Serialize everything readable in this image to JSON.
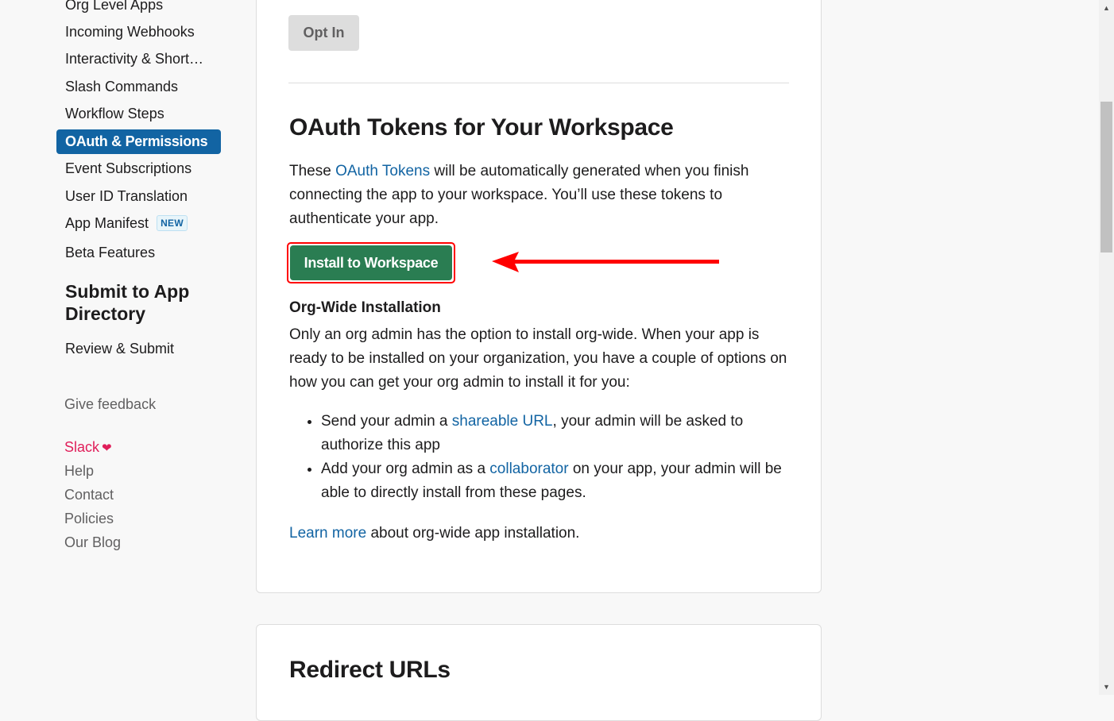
{
  "sidebar": {
    "items": [
      {
        "label": "Org Level Apps"
      },
      {
        "label": "Incoming Webhooks"
      },
      {
        "label": "Interactivity & Short…"
      },
      {
        "label": "Slash Commands"
      },
      {
        "label": "Workflow Steps"
      },
      {
        "label": "OAuth & Permissions",
        "active": true
      },
      {
        "label": "Event Subscriptions"
      },
      {
        "label": "User ID Translation"
      },
      {
        "label": "App Manifest",
        "badge": "NEW"
      },
      {
        "label": "Beta Features"
      }
    ],
    "section_title": "Submit to App Directory",
    "section_items": [
      {
        "label": "Review & Submit"
      }
    ],
    "footer": {
      "feedback": "Give feedback",
      "links": [
        "Slack",
        "Help",
        "Contact",
        "Policies",
        "Our Blog"
      ]
    }
  },
  "main": {
    "opt_in_label": "Opt In",
    "oauth_section": {
      "title": "OAuth Tokens for Your Workspace",
      "intro_before": "These ",
      "intro_link": "OAuth Tokens",
      "intro_after": " will be automatically generated when you finish connecting the app to your workspace. You’ll use these tokens to authenticate your app.",
      "install_label": "Install to Workspace",
      "org_wide_title": "Org-Wide Installation",
      "org_wide_text": "Only an org admin has the option to install org-wide. When your app is ready to be installed on your organization, you have a couple of options on how you can get your org admin to install it for you:",
      "bullets": [
        {
          "before": "Send your admin a ",
          "link": "shareable URL",
          "after": ", your admin will be asked to authorize this app"
        },
        {
          "before": "Add your org admin as a ",
          "link": "collaborator",
          "after": " on your app, your admin will be able to directly install from these pages."
        }
      ],
      "learn_more_link": "Learn more",
      "learn_more_after": " about org-wide app installation."
    },
    "redirect_section": {
      "title": "Redirect URLs"
    }
  },
  "colors": {
    "accent": "#1264a3",
    "install_button": "#2a7d52",
    "highlight": "#ff0000",
    "slack_heart": "#e01e5a"
  }
}
